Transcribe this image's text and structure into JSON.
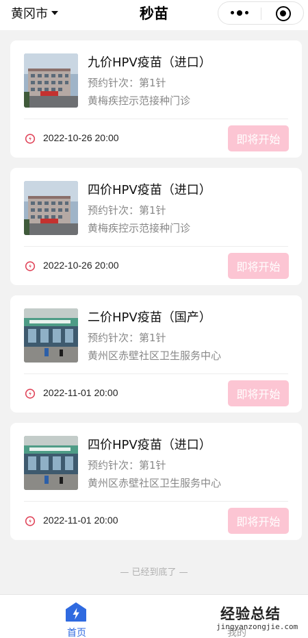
{
  "header": {
    "city": "黄冈市",
    "title": "秒苗"
  },
  "cards": [
    {
      "name": "九价HPV疫苗（进口）",
      "dose": "预约针次：第1针",
      "clinic": "黄梅疾控示范接种门诊",
      "time": "2022-10-26 20:00",
      "status": "即将开始"
    },
    {
      "name": "四价HPV疫苗（进口）",
      "dose": "预约针次：第1针",
      "clinic": "黄梅疾控示范接种门诊",
      "time": "2022-10-26 20:00",
      "status": "即将开始"
    },
    {
      "name": "二价HPV疫苗（国产）",
      "dose": "预约针次：第1针",
      "clinic": "黄州区赤壁社区卫生服务中心",
      "time": "2022-11-01 20:00",
      "status": "即将开始"
    },
    {
      "name": "四价HPV疫苗（进口）",
      "dose": "预约针次：第1针",
      "clinic": "黄州区赤壁社区卫生服务中心",
      "time": "2022-11-01 20:00",
      "status": "即将开始"
    }
  ],
  "end_note": "— 已经到底了 —",
  "tabbar": {
    "home_label": "首页",
    "mine_label": "我的"
  },
  "watermark": {
    "main": "经验总结",
    "sub": "jingyanzongjie.com"
  },
  "colors": {
    "accent": "#2f6ae0",
    "status_button": "#fcc5d3",
    "clock_icon": "#e0455a"
  }
}
